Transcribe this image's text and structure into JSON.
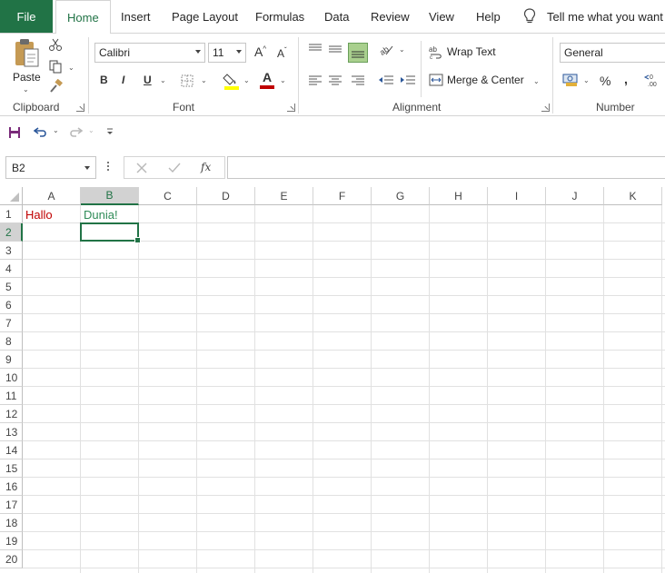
{
  "tabs": {
    "file": "File",
    "home": "Home",
    "insert": "Insert",
    "page_layout": "Page Layout",
    "formulas": "Formulas",
    "data": "Data",
    "review": "Review",
    "view": "View",
    "help": "Help",
    "tell_me": "Tell me what you want to"
  },
  "ribbon": {
    "clipboard": {
      "label": "Clipboard",
      "paste": "Paste"
    },
    "font": {
      "label": "Font",
      "name": "Calibri",
      "size": "11",
      "bold": "B",
      "italic": "I",
      "underline": "U",
      "grow": "A",
      "shrink": "A",
      "font_color_letter": "A",
      "font_color": "#c00000",
      "fill_color": "#ffff00"
    },
    "alignment": {
      "label": "Alignment",
      "wrap_text": "Wrap Text",
      "merge_center": "Merge & Center"
    },
    "number": {
      "label": "Number",
      "format": "General",
      "percent": "%",
      "comma": ","
    }
  },
  "formula_bar": {
    "name_box": "B2",
    "fx": "fx",
    "content": ""
  },
  "sheet": {
    "columns": [
      "A",
      "B",
      "C",
      "D",
      "E",
      "F",
      "G",
      "H",
      "I",
      "J",
      "K"
    ],
    "rows": [
      "1",
      "2",
      "3",
      "4",
      "5",
      "6",
      "7",
      "8",
      "9",
      "10",
      "11",
      "12",
      "13",
      "14",
      "15",
      "16",
      "17",
      "18",
      "19",
      "20"
    ],
    "selected_column": "B",
    "selected_row": "2",
    "cells": {
      "A1": {
        "value": "Hallo",
        "color": "#c00000"
      },
      "B1": {
        "value": "Dunia!",
        "color": "#2e8b57"
      }
    },
    "active_cell": "B2"
  },
  "colors": {
    "brand": "#217346",
    "gridline": "#e1e1e1"
  }
}
